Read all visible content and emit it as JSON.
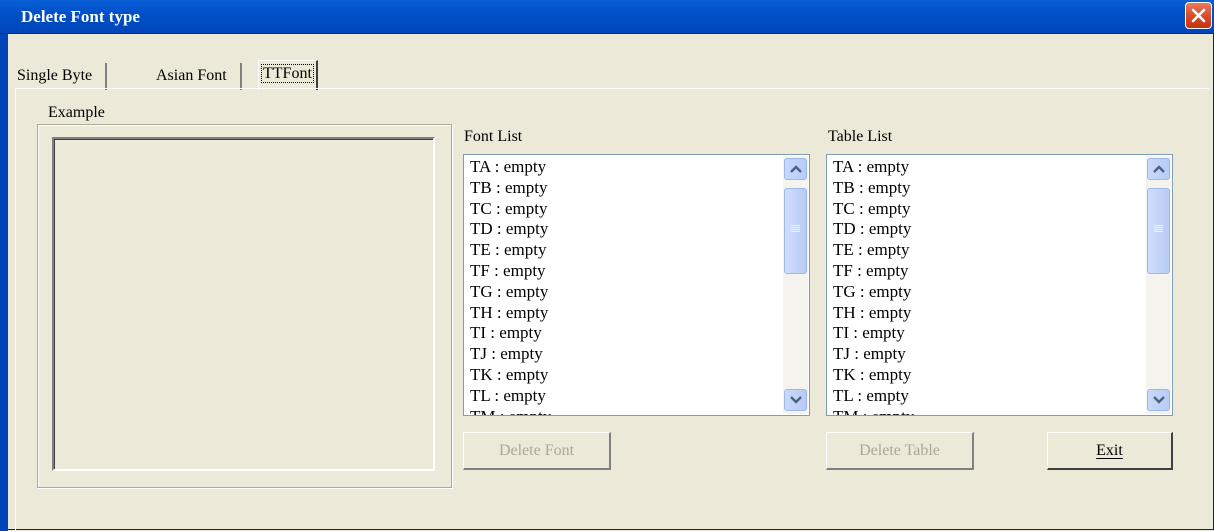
{
  "window": {
    "title": "Delete Font type"
  },
  "tabs": [
    {
      "label": "Single Byte",
      "active": false
    },
    {
      "label": "Asian Font",
      "active": false
    },
    {
      "label": "TTFont",
      "active": true
    }
  ],
  "example_group": {
    "label": "Example"
  },
  "font_list": {
    "label": "Font List",
    "items": [
      "TA : empty",
      "TB : empty",
      "TC : empty",
      "TD : empty",
      "TE : empty",
      "TF : empty",
      "TG : empty",
      "TH : empty",
      "TI : empty",
      "TJ : empty",
      "TK : empty",
      "TL : empty",
      "TM : empty"
    ]
  },
  "table_list": {
    "label": "Table List",
    "items": [
      "TA : empty",
      "TB : empty",
      "TC : empty",
      "TD : empty",
      "TE : empty",
      "TF : empty",
      "TG : empty",
      "TH : empty",
      "TI : empty",
      "TJ : empty",
      "TK : empty",
      "TL : empty",
      "TM : empty"
    ]
  },
  "buttons": {
    "delete_font": "Delete Font",
    "delete_table": "Delete Table",
    "exit": "Exit"
  },
  "icons": {
    "close": "close-icon",
    "scroll_up": "chevron-up-icon",
    "scroll_down": "chevron-down-icon"
  }
}
